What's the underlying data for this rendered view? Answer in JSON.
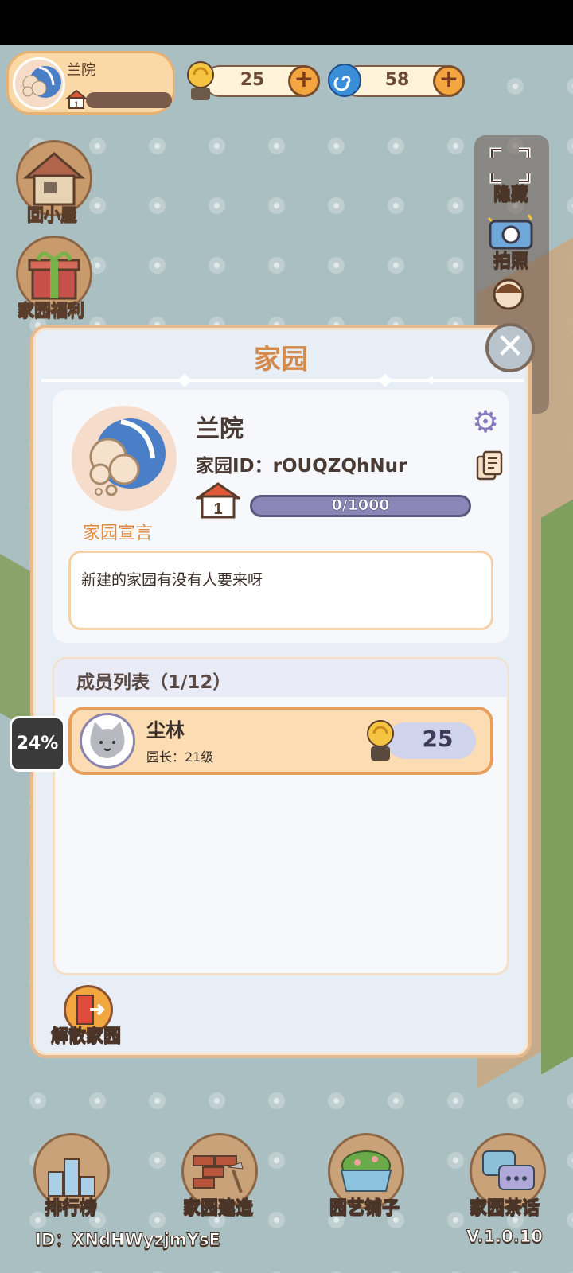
{
  "top_bar": {
    "profile_name": "兰院",
    "profile_level": "1",
    "snail_count": "25",
    "swirl_count": "58"
  },
  "left_menu": {
    "home_label": "回小屋",
    "welfare_label": "家园福利"
  },
  "right_menu": {
    "hide_label": "隐藏",
    "photo_label": "拍照"
  },
  "dialog": {
    "title": "家园",
    "home_name": "兰院",
    "home_id": "家园ID：rOUQZQhNur",
    "level": "1",
    "progress_text": "0/1000",
    "progress_fraction": 0,
    "manifesto_label": "家园宣言",
    "manifesto_text": "新建的家园有没有人要来呀",
    "members_title": "成员列表（1/12）",
    "members": [
      {
        "name": "尘林",
        "role": "园长：21级",
        "score": "25"
      }
    ],
    "dissolve_label": "解散家园"
  },
  "side_badge": {
    "percent": "24%"
  },
  "bottom_nav": [
    {
      "label": "排行榜",
      "icon": "ranking-icon"
    },
    {
      "label": "家园建造",
      "icon": "build-icon"
    },
    {
      "label": "园艺铺子",
      "icon": "garden-shop-icon"
    },
    {
      "label": "家园茶话",
      "icon": "chat-icon"
    }
  ],
  "footer": {
    "user_id": "ID：XNdHWyzjmYsE",
    "version": "V.1.0.10"
  },
  "colors": {
    "accent": "#d48a4a",
    "panel": "#e7eef6",
    "progress": "#8a86b8"
  }
}
